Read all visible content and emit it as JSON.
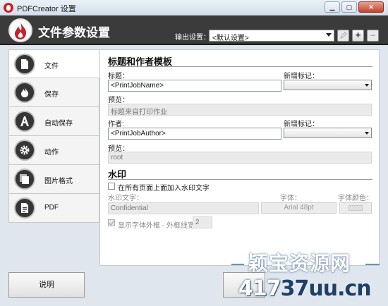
{
  "window": {
    "title": "PDFCreator 设置"
  },
  "header": {
    "heading": "文件参数设置",
    "profile_label": "输出设置：",
    "profile_value": "<默认设置>",
    "add_label": "+",
    "remove_label": "–"
  },
  "nav": {
    "items": [
      {
        "label": "文件",
        "icon": "document-icon",
        "active": true
      },
      {
        "label": "保存",
        "icon": "flame-icon"
      },
      {
        "label": "自动保存",
        "icon": "letter-a-icon"
      },
      {
        "label": "动作",
        "icon": "gear-icon"
      },
      {
        "label": "图片格式",
        "icon": "images-icon"
      },
      {
        "label": "PDF",
        "icon": "pdf-document-icon"
      }
    ]
  },
  "main": {
    "template_section": {
      "title": "标题和作者模板",
      "title_label": "标题：",
      "title_value": "<PrintJobName>",
      "title_token_label": "新增标记：",
      "title_preview_label": "预览：",
      "title_preview_value": "标题来自打印作业",
      "author_label": "作者:",
      "author_value": "<PrintJobAuthor>",
      "author_token_label": "新增标记：",
      "author_preview_label": "预览：",
      "author_preview_value": "root"
    },
    "watermark_section": {
      "title": "水印",
      "enable_label": "在所有页面上面加入水印文字",
      "text_label": "水印文字：",
      "text_value": "Confidential",
      "font_label": "字体：",
      "font_value": "Arial 48pt",
      "color_label": "字体颜色：",
      "outline_label": "显示字体外框 - 外框线宽：",
      "outline_width": "2"
    }
  },
  "footer": {
    "help_label": "说明"
  },
  "overlay": {
    "line1": "颖宝资源网",
    "line2_a": "417",
    "line2_b": "37uu.cn"
  },
  "colors": {
    "header_bg": "#3b3b3b",
    "accent_red": "#c82128"
  }
}
